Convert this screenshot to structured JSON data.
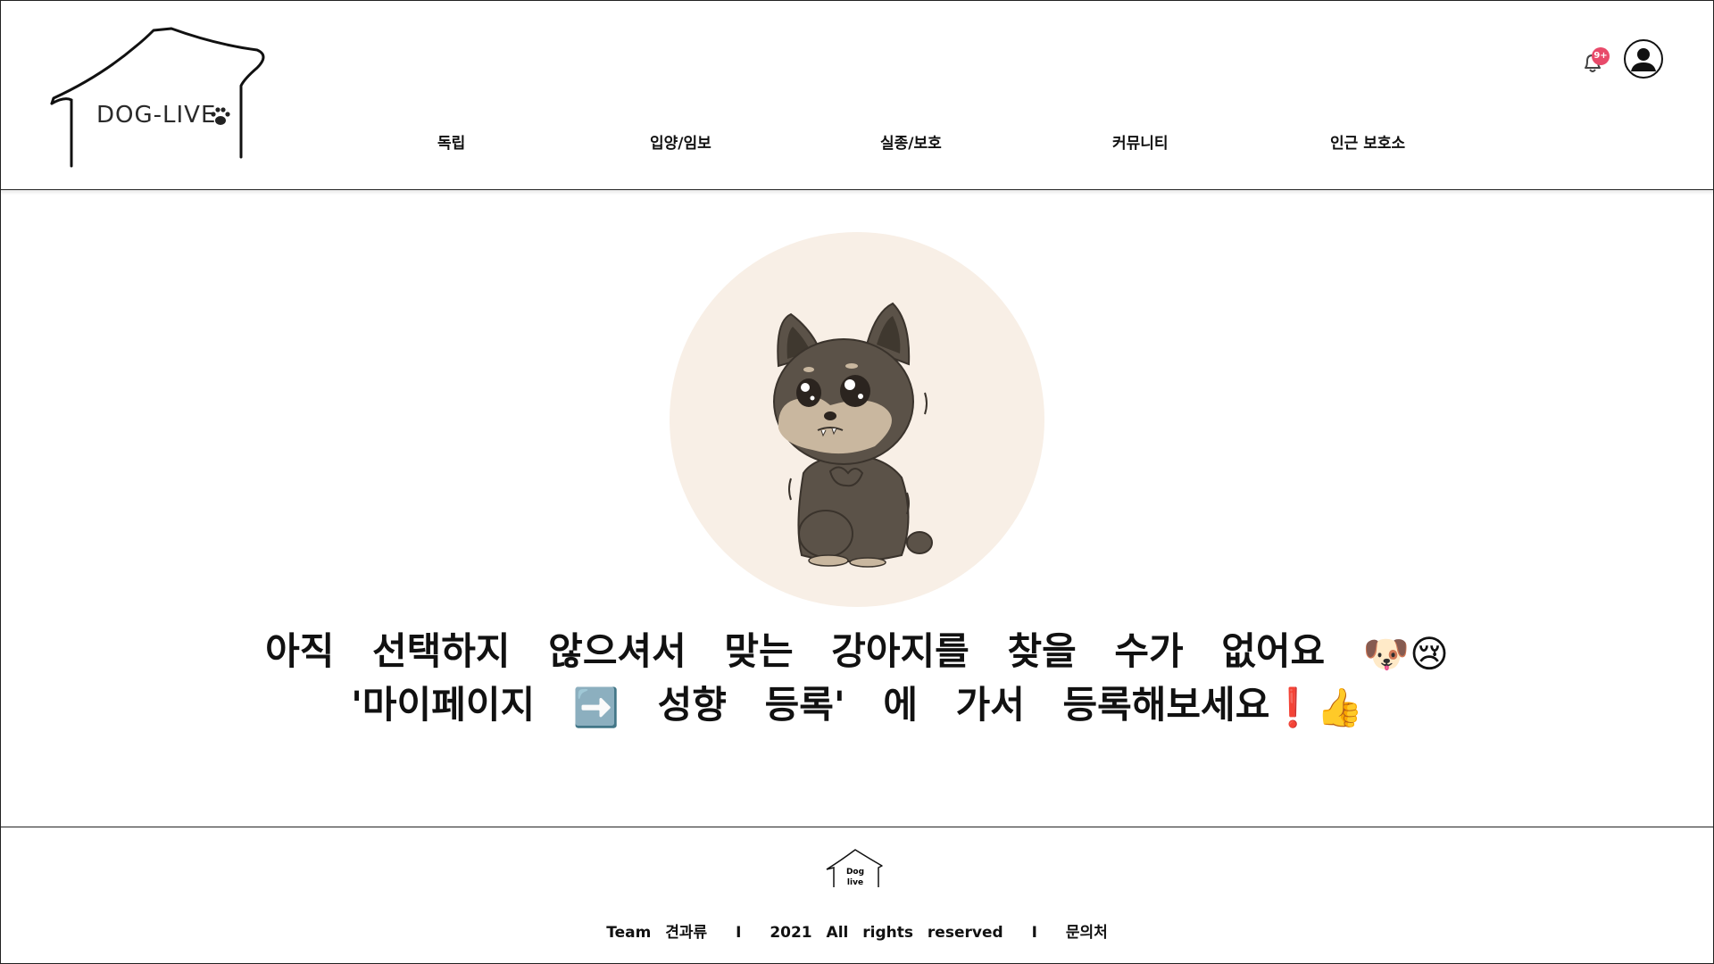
{
  "header": {
    "logo_text": "DOG-LIVE",
    "nav": [
      "독립",
      "입양/임보",
      "실종/보호",
      "커뮤니티",
      "인근 보호소"
    ],
    "notification_badge": "9+"
  },
  "main": {
    "message_line1": "아직 선택하지 않으셔서 맞는 강아지를 찾을 수가 없어요",
    "message_line1_emoji": [
      "🐶",
      "😢"
    ],
    "message_line2_part1": "'마이페이지",
    "message_line2_arrow": "➡️",
    "message_line2_part2": "성향 등록' 에 가서 등록해보세요",
    "message_line2_emoji": [
      "❗",
      "👍"
    ]
  },
  "footer": {
    "logo_text_top": "Dog",
    "logo_text_bottom": "live",
    "team": "Team 견과류",
    "separator": "I",
    "copyright": "2021 All rights reserved",
    "inquiry": "문의처"
  },
  "colors": {
    "circle_bg": "#f8efe6",
    "badge": "#e84a6a",
    "dog_body": "#5b5248",
    "dog_muzzle": "#c9b79f"
  }
}
